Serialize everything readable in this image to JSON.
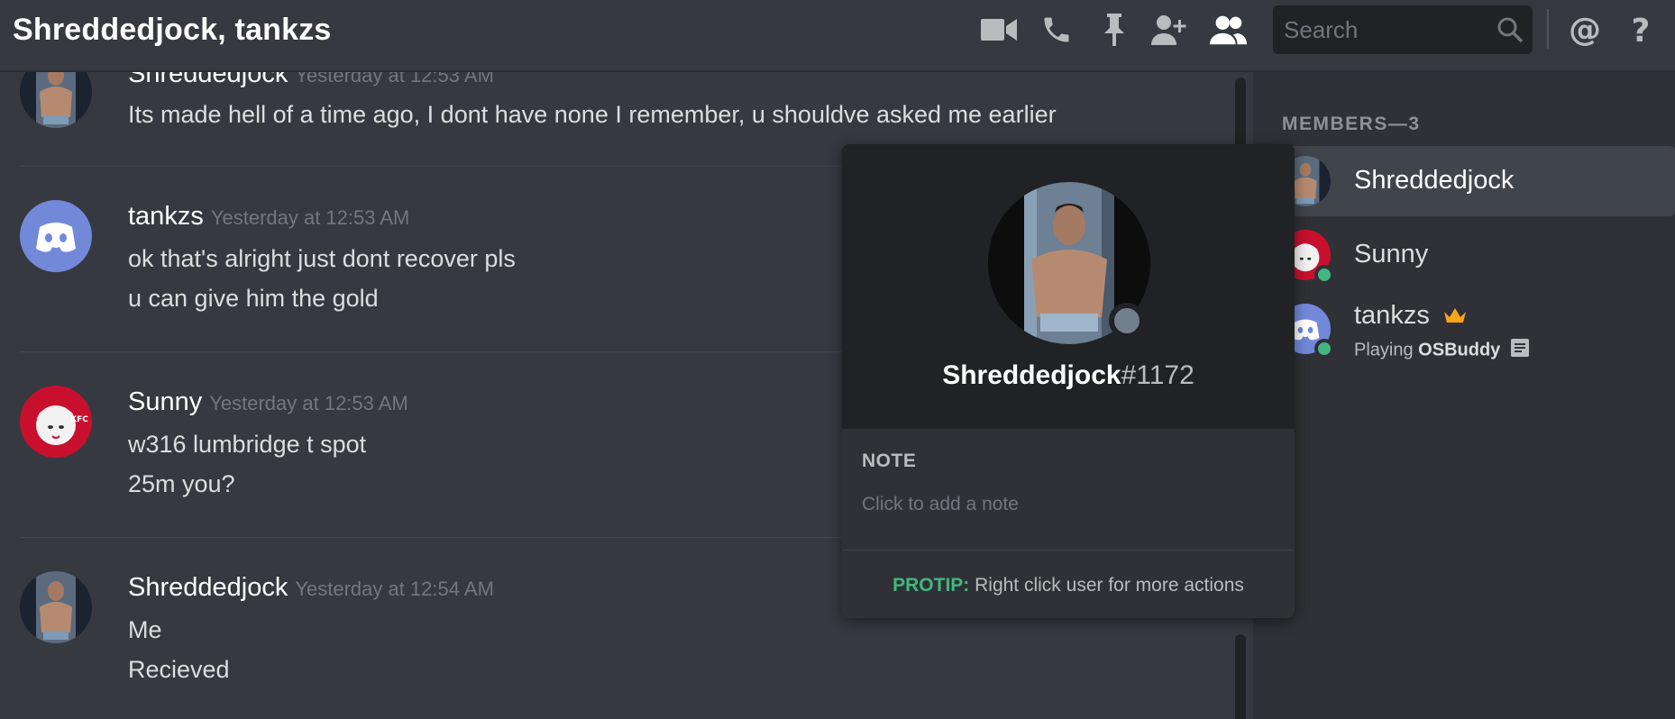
{
  "header": {
    "title": "Shreddedjock, tankzs",
    "search_placeholder": "Search"
  },
  "messages": [
    {
      "author": "Shreddedjock",
      "time": "Yesterday at 12:53 AM",
      "lines": [
        "Its made hell of a time ago, I dont have none I remember, u shouldve asked me earlier"
      ]
    },
    {
      "author": "tankzs",
      "time": "Yesterday at 12:53 AM",
      "lines": [
        "ok that's alright just dont recover pls",
        "u can give him the gold"
      ]
    },
    {
      "author": "Sunny",
      "time": "Yesterday at 12:53 AM",
      "lines": [
        "w316 lumbridge t spot",
        "25m you?"
      ]
    },
    {
      "author": "Shreddedjock",
      "time": "Yesterday at 12:54 AM",
      "lines": [
        "Me",
        "Recieved"
      ]
    }
  ],
  "members": {
    "title": "MEMBERS—3",
    "list": [
      {
        "name": "Shreddedjock"
      },
      {
        "name": "Sunny"
      },
      {
        "name": "tankzs",
        "activity_prefix": "Playing",
        "activity": "OSBuddy"
      }
    ]
  },
  "popout": {
    "username": "Shreddedjock",
    "discriminator": "#1172",
    "note_label": "NOTE",
    "note_placeholder": "Click to add a note",
    "protip_label": "PROTIP:",
    "protip_text": " Right click user for more actions"
  },
  "colors": {
    "background": "#36393f",
    "sidebar": "#2f3136",
    "popout_top": "#202225",
    "online": "#43b581",
    "offline": "#747f8d",
    "crown": "#faa61a",
    "blurple": "#7289da"
  },
  "icons": [
    "video-call-icon",
    "phone-icon",
    "pin-icon",
    "add-member-icon",
    "members-icon",
    "search-icon",
    "mention-icon",
    "help-icon",
    "crown-icon",
    "rich-presence-icon"
  ]
}
